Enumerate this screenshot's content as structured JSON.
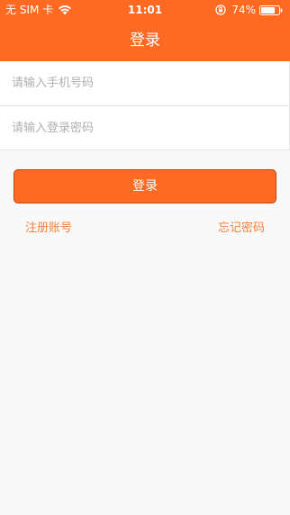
{
  "status_bar": {
    "carrier": "无 SIM 卡",
    "time": "11:01",
    "battery": "74%",
    "icons": [
      "wifi-icon",
      "rotation-lock-icon",
      "battery-icon"
    ]
  },
  "header": {
    "title": "登录"
  },
  "form": {
    "phone_placeholder": "请输入手机号码",
    "password_placeholder": "请输入登录密码"
  },
  "actions": {
    "login_label": "登录",
    "register_label": "注册账号",
    "forgot_label": "忘记密码"
  },
  "colors": {
    "accent": "#fe6a22",
    "link": "#f2813a",
    "background": "#f9f9f9"
  }
}
